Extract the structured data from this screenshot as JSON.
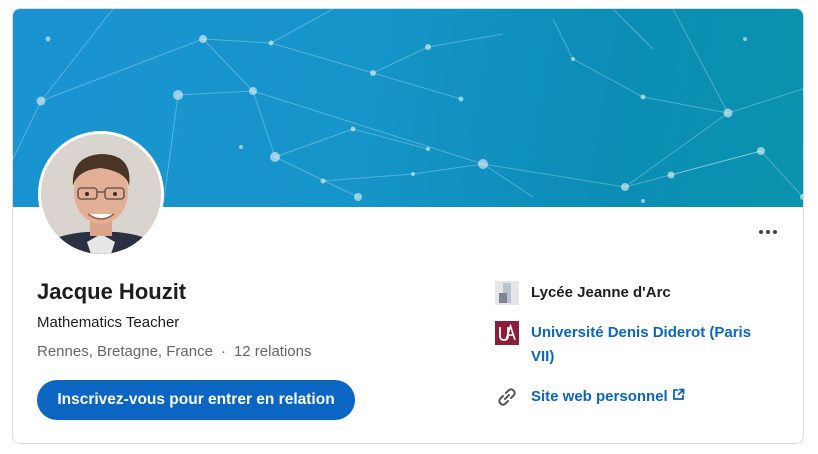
{
  "profile": {
    "name": "Jacque Houzit",
    "headline": "Mathematics Teacher",
    "location": "Rennes, Bretagne, France",
    "separator": "·",
    "connections": "12 relations"
  },
  "actions": {
    "connect_label": "Inscrivez-vous pour entrer en relation",
    "more_icon": "more-horizontal-icon"
  },
  "sidebar": {
    "items": [
      {
        "label": "Lycée Jeanne d'Arc",
        "icon": "school-logo-icon"
      },
      {
        "label": "Université Denis Diderot (Paris VII)",
        "icon": "university-logo-icon"
      },
      {
        "label": "Site web personnel",
        "icon": "link-icon",
        "trailing_icon": "external-link-icon"
      }
    ]
  },
  "colors": {
    "accent": "#0a66c2",
    "banner": "#1595c9",
    "university_logo": "#8c1d3a"
  }
}
